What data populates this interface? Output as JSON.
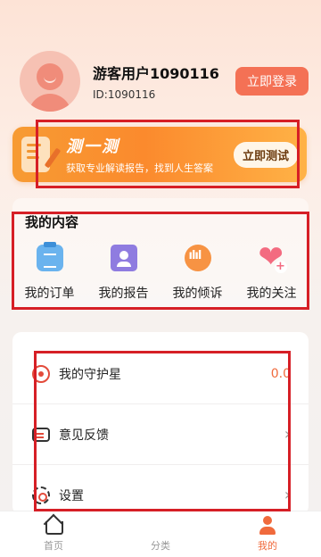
{
  "profile": {
    "username": "游客用户1090116",
    "user_id": "ID:1090116",
    "login_label": "立即登录"
  },
  "banner": {
    "title": "测一测",
    "subtitle": "获取专业解读报告，找到人生答案",
    "button_label": "立即测试"
  },
  "my_content": {
    "title": "我的内容",
    "items": [
      {
        "label": "我的订单",
        "icon": "clipboard-icon"
      },
      {
        "label": "我的报告",
        "icon": "report-icon"
      },
      {
        "label": "我的倾诉",
        "icon": "voice-chat-icon"
      },
      {
        "label": "我的关注",
        "icon": "heart-plus-icon"
      }
    ]
  },
  "settings_list": [
    {
      "label": "我的守护星",
      "value": "0.0",
      "icon": "guardian-star-icon"
    },
    {
      "label": "意见反馈",
      "value": "",
      "icon": "feedback-icon"
    },
    {
      "label": "设置",
      "value": "",
      "icon": "gear-icon"
    }
  ],
  "tabbar": {
    "tabs": [
      {
        "label": "首页",
        "icon": "home-icon",
        "active": false
      },
      {
        "label": "分类",
        "icon": "category-icon",
        "active": false
      },
      {
        "label": "我的",
        "icon": "profile-icon",
        "active": true
      }
    ]
  },
  "colors": {
    "accent": "#f06a3c",
    "login_button": "#f47155",
    "banner_orange": "#fb8a2d",
    "annotation_red": "#d61f26"
  }
}
